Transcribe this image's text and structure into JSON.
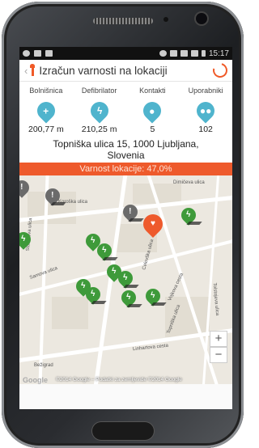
{
  "status_bar": {
    "time": "15:17"
  },
  "app_bar": {
    "title": "Izračun varnosti na lokaciji"
  },
  "stats": [
    {
      "label": "Bolnišnica",
      "value": "200,77 m",
      "icon": "plus-icon"
    },
    {
      "label": "Defibrilator",
      "value": "210,25 m",
      "icon": "bolt-icon"
    },
    {
      "label": "Kontakti",
      "value": "5",
      "icon": "person-icon"
    },
    {
      "label": "Uporabniki",
      "value": "102",
      "icon": "group-icon"
    }
  ],
  "address": "Topniška ulica 15, 1000 Ljubljana, Slovenia",
  "safety": "Varnost lokacije: 47,0%",
  "map": {
    "streets": [
      "Koroška ulica",
      "Dimičeva ulica",
      "Samova ulica",
      "Stanetova ulica",
      "Linhartova cesta",
      "Bežigrad",
      "Vojkova cesta",
      "Topniška ulica",
      "Celovška ulica",
      "Tolstojeva ulica"
    ],
    "zoom_in": "+",
    "zoom_out": "−",
    "logo": "Google",
    "attribution": "©2014 Google – Podatki za zemljevide ©2014 Google"
  },
  "colors": {
    "accent": "#ee5a2c",
    "pin_blue": "#4fb4cd",
    "pin_green": "#3e9a3a"
  }
}
